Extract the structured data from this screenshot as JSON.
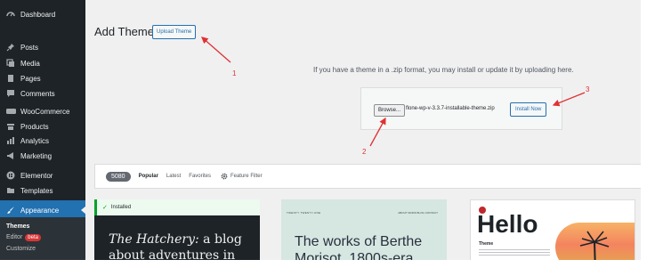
{
  "sidebar": {
    "items": [
      {
        "label": "Dashboard",
        "icon": "dashboard-icon"
      },
      {
        "label": "Posts",
        "icon": "pin-icon"
      },
      {
        "label": "Media",
        "icon": "media-icon"
      },
      {
        "label": "Pages",
        "icon": "page-icon"
      },
      {
        "label": "Comments",
        "icon": "comment-icon"
      },
      {
        "label": "WooCommerce",
        "icon": "woo-icon"
      },
      {
        "label": "Products",
        "icon": "archive-icon"
      },
      {
        "label": "Analytics",
        "icon": "chart-bars-icon"
      },
      {
        "label": "Marketing",
        "icon": "megaphone-icon"
      },
      {
        "label": "Elementor",
        "icon": "elementor-icon"
      },
      {
        "label": "Templates",
        "icon": "folder-icon"
      },
      {
        "label": "Appearance",
        "icon": "paintbrush-icon"
      }
    ],
    "submenu": [
      {
        "label": "Themes"
      },
      {
        "label": "Editor",
        "badge": "beta"
      },
      {
        "label": "Customize"
      }
    ]
  },
  "header": {
    "title": "Add Themes",
    "upload_button": "Upload Theme"
  },
  "upload": {
    "description": "If you have a theme in a .zip format, you may install or update it by uploading here.",
    "browse_label": "Browse...",
    "filename": "flone-wp-v-3.3.7-installable-theme.zip",
    "install_label": "Install Now"
  },
  "filter": {
    "count": "5080",
    "tabs": [
      "Popular",
      "Latest",
      "Favorites"
    ],
    "feature_filter": "Feature Filter"
  },
  "themes": {
    "card1": {
      "status": "Installed",
      "preview_em": "The Hatchery:",
      "preview_rest": " a blog about adventures in"
    },
    "card2": {
      "header": "TWENTY TWENTY-ONE",
      "nav": "ABOUT  WORK  BLOG  CONTACT",
      "preview": "The works of Berthe Morisot, 1800s-era"
    },
    "card3": {
      "logo_text": "Hello",
      "subtitle": "Theme"
    }
  },
  "annotations": [
    "1",
    "2",
    "3"
  ],
  "colors": {
    "sidebar_bg": "#1d2327",
    "accent": "#2271b1",
    "annotation": "#e03131",
    "installed": "#00a32a"
  }
}
